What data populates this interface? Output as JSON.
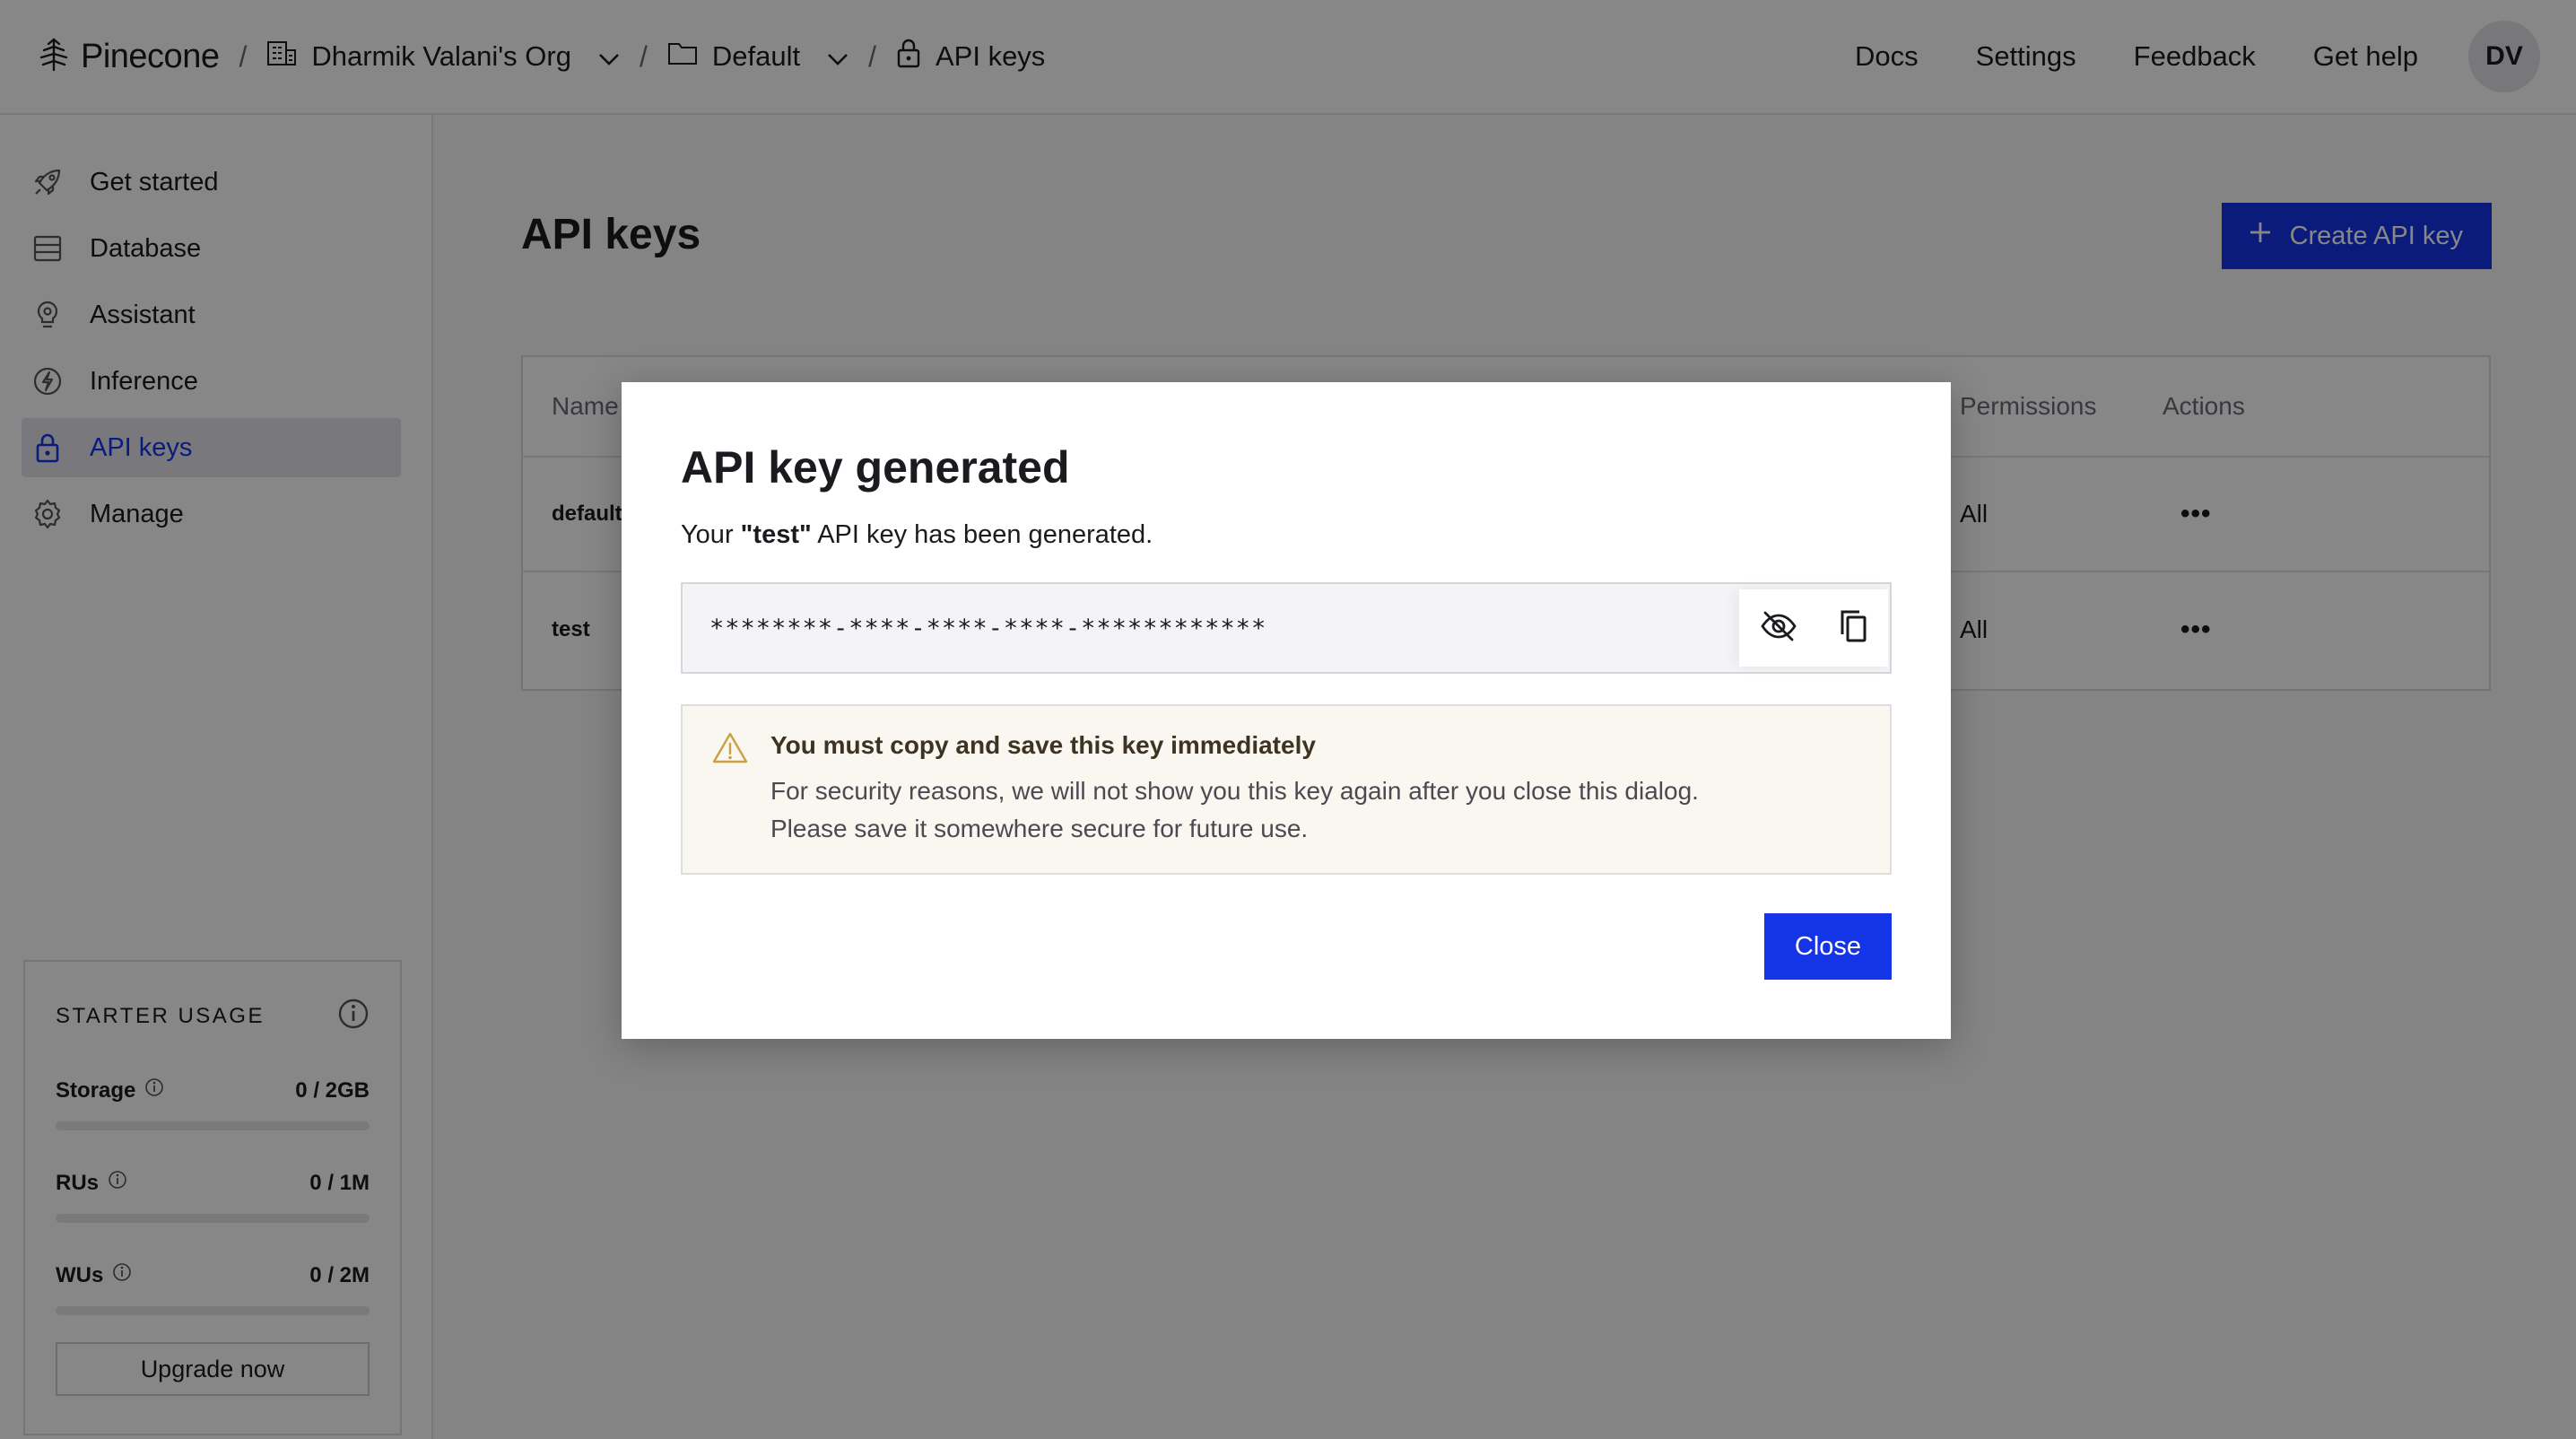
{
  "header": {
    "logo_text": "Pinecone",
    "breadcrumbs": [
      {
        "label": "Dharmik Valani's Org",
        "icon": "building-icon",
        "has_dropdown": true
      },
      {
        "label": "Default",
        "icon": "folder-icon",
        "has_dropdown": true
      },
      {
        "label": "API keys",
        "icon": "lock-icon",
        "has_dropdown": false
      }
    ],
    "separator": "/",
    "links": [
      "Docs",
      "Settings",
      "Feedback",
      "Get help"
    ],
    "avatar_initials": "DV"
  },
  "sidebar": {
    "items": [
      {
        "label": "Get started",
        "icon": "rocket-icon",
        "active": false
      },
      {
        "label": "Database",
        "icon": "database-icon",
        "active": false
      },
      {
        "label": "Assistant",
        "icon": "bulb-icon",
        "active": false
      },
      {
        "label": "Inference",
        "icon": "bolt-icon",
        "active": false
      },
      {
        "label": "API keys",
        "icon": "lock-icon",
        "active": true
      },
      {
        "label": "Manage",
        "icon": "gear-icon",
        "active": false
      }
    ],
    "usage": {
      "title": "STARTER USAGE",
      "rows": [
        {
          "label": "Storage",
          "value": "0 / 2GB",
          "fraction": 0
        },
        {
          "label": "RUs",
          "value": "0 / 1M",
          "fraction": 0
        },
        {
          "label": "WUs",
          "value": "0 / 2M",
          "fraction": 0
        }
      ],
      "upgrade_label": "Upgrade now"
    }
  },
  "main": {
    "title": "API keys",
    "create_button": "Create API key",
    "table": {
      "headers": {
        "name": "Name",
        "permissions": "Permissions",
        "actions": "Actions"
      },
      "rows": [
        {
          "name": "default",
          "permissions": "All",
          "actions": "•••"
        },
        {
          "name": "test",
          "permissions": "All",
          "actions": "•••"
        }
      ]
    }
  },
  "modal": {
    "title": "API key generated",
    "desc_prefix": "Your ",
    "key_name": "\"test\"",
    "desc_suffix": " API key has been generated.",
    "masked_key": "********-****-****-****-************",
    "warning_title": "You must copy and save this key immediately",
    "warning_line1": "For security reasons, we will not show you this key again after you close this dialog.",
    "warning_line2": "Please save it somewhere secure for future use.",
    "close_button": "Close"
  },
  "colors": {
    "accent": "#1434e8",
    "warning_icon": "#c9a043",
    "overlay": "rgba(0,0,0,0.47)"
  }
}
